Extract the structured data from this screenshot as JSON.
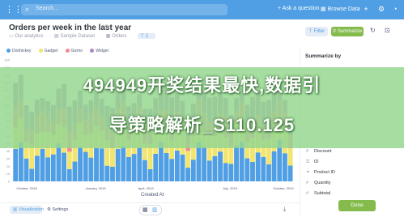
{
  "topbar": {
    "search_placeholder": "Search...",
    "ask_question": "Ask a question",
    "browse_data": "Browse Data"
  },
  "header": {
    "title": "Orders per week in the last year",
    "breadcrumbs": [
      "Our analytics",
      "Sample Dataset",
      "Orders"
    ],
    "filter_count": "1",
    "filter_label": "Filter",
    "summarize_label": "Summarize"
  },
  "chart_data": {
    "type": "bar",
    "stacked": true,
    "series": [
      {
        "name": "Doohickey",
        "color": "#509ee3"
      },
      {
        "name": "Gadget",
        "color": "#f2e56e"
      },
      {
        "name": "Gizmo",
        "color": "#ef8c8c"
      },
      {
        "name": "Widget",
        "color": "#a989c5"
      }
    ],
    "y_ticks": [
      "160",
      "150",
      "140",
      "130",
      "120",
      "110",
      "100",
      "90",
      "80",
      "70",
      "60",
      "50",
      "40",
      "30",
      "20",
      "10",
      "0"
    ],
    "x_ticks": [
      "October, 2018",
      "January, 2019",
      "April, 2019",
      "July, 2019",
      "October, 2019"
    ],
    "xlabel": "Created At",
    "ylim": [
      0,
      160
    ]
  },
  "footer": {
    "visualization_label": "Visualization",
    "settings_label": "Settings"
  },
  "sidebar": {
    "title": "Summarize by",
    "fields": [
      "Discount",
      "ID",
      "Product ID",
      "Quantity",
      "Subtotal"
    ],
    "done_label": "Done"
  },
  "overlay": {
    "line1": "494949开奖结果最快,数据引",
    "line2": "导策略解析_S110.125"
  }
}
